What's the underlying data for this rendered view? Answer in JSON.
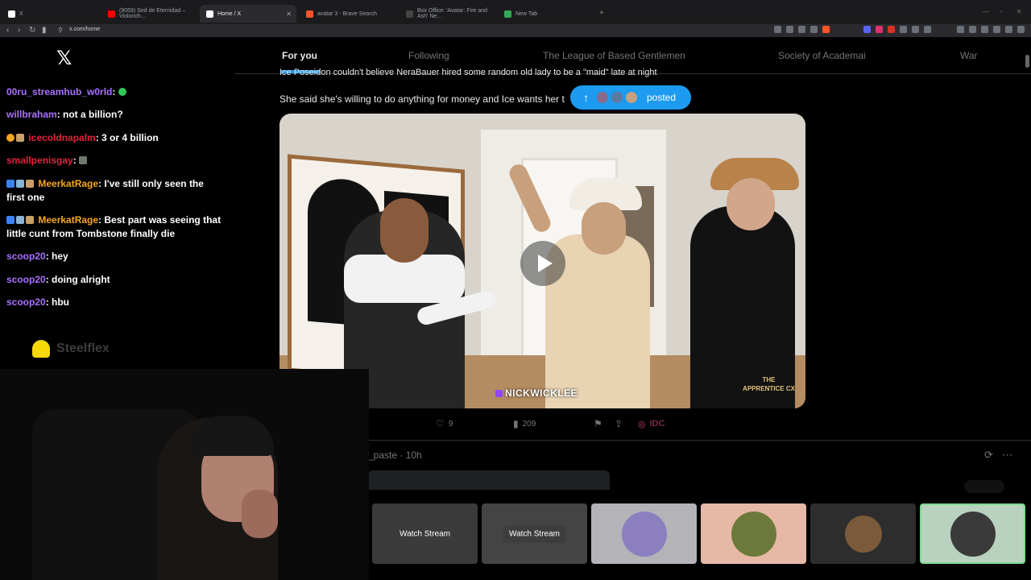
{
  "browser": {
    "tabs": [
      {
        "label": "X",
        "favicon_color": "#ffffff"
      },
      {
        "label": "(9059) Sed de Eternidad – Violonch…",
        "favicon_color": "#ff0000"
      },
      {
        "label": "Home / X",
        "favicon_color": "#ffffff"
      },
      {
        "label": "avatar 3 - Brave Search",
        "favicon_color": "#fb542b"
      },
      {
        "label": "Box Office: 'Avatar: Fire and Ash' Ne…",
        "favicon_color": "#444444"
      },
      {
        "label": "New Tab",
        "favicon_color": "#34a853"
      }
    ],
    "url": "x.com/home"
  },
  "chat": {
    "messages": [
      {
        "user": "00ru_streamhub_w0rld",
        "text": "",
        "color": "#a970ff"
      },
      {
        "user": "willbraham",
        "text": ": not a billion?",
        "color": "#a970ff"
      },
      {
        "user": "icecoldnapalm",
        "text": ": 3 or 4 billion",
        "color": "#e0243b"
      },
      {
        "user": "smallpenisgay",
        "text": ": ",
        "color": "#e0243b"
      },
      {
        "user": "MeerkatRage",
        "text": ": I've still only seen the first one",
        "color": "#f5a623"
      },
      {
        "user": "MeerkatRage",
        "text": ": Best part was seeing that little cunt from Tombstone finally die",
        "color": "#f5a623"
      },
      {
        "user": "scoop20",
        "text": ": hey",
        "color": "#a970ff"
      },
      {
        "user": "scoop20",
        "text": ": doing alright",
        "color": "#a970ff"
      },
      {
        "user": "scoop20",
        "text": ": hbu",
        "color": "#a970ff"
      }
    ],
    "snapchat_name": "Steelflex"
  },
  "x": {
    "tabs": [
      "For you",
      "Following",
      "The League of Based Gentlemen",
      "Society of Academai",
      "War"
    ],
    "post": {
      "line1": "Ice Poseidon couldn't believe NeraBauer hired some random old lady to be a \"maid\" late at night",
      "line2": "She said she's willing to do anything for money and Ice wants her t",
      "posted_label": "posted",
      "watermark": "NICKWICKLEE",
      "logo_text": "THE APPRENTICE CX",
      "likes": "9",
      "views": "209",
      "badge": "IDC"
    },
    "next_post": {
      "meta": "_paste · 10h"
    }
  },
  "streams": {
    "watch_label": "Watch Stream"
  },
  "colors": {
    "accent": "#1d9bf0",
    "background": "#000000"
  }
}
